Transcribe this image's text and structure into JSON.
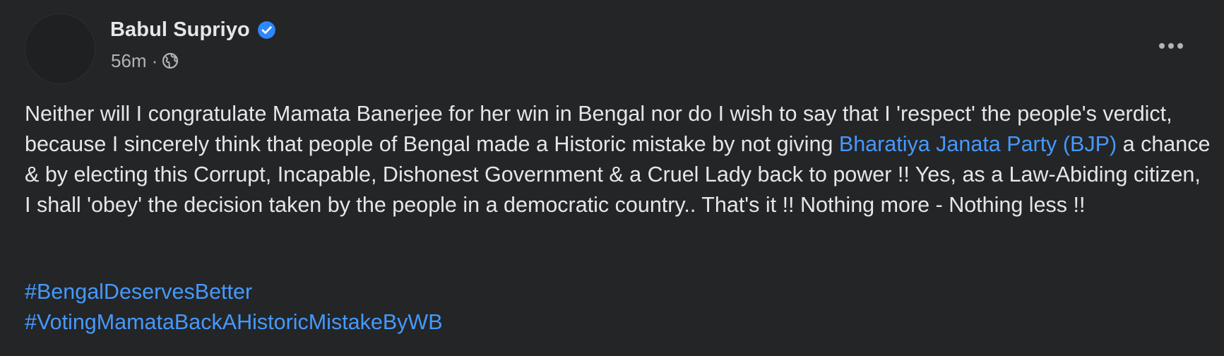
{
  "post": {
    "author": "Babul Supriyo",
    "timestamp": "56m",
    "separator": "·",
    "audience_icon": "globe-icon",
    "verified_icon": "verified-badge-icon",
    "more_icon": "more-options-icon",
    "text_part1": "Neither will I congratulate Mamata Banerjee for her win in Bengal nor do I wish to say that I 'respect' the people's verdict, because I sincerely think that people of Bengal made a Historic mistake by not giving ",
    "mention": "Bharatiya Janata Party (BJP)",
    "text_part2": " a chance & by electing this Corrupt, Incapable, Dishonest Government & a Cruel Lady back to power !! Yes, as a Law-Abiding citizen, I shall 'obey' the decision taken by the people in a democratic country.. That's it !! Nothing more - Nothing less !!",
    "hashtags": [
      "#BengalDeservesBetter",
      "#VotingMamataBackAHistoricMistakeByWB"
    ]
  },
  "colors": {
    "background": "#242526",
    "text_primary": "#e4e6eb",
    "text_secondary": "#b0b3b8",
    "link": "#4599ff",
    "verified": "#2d88ff"
  }
}
